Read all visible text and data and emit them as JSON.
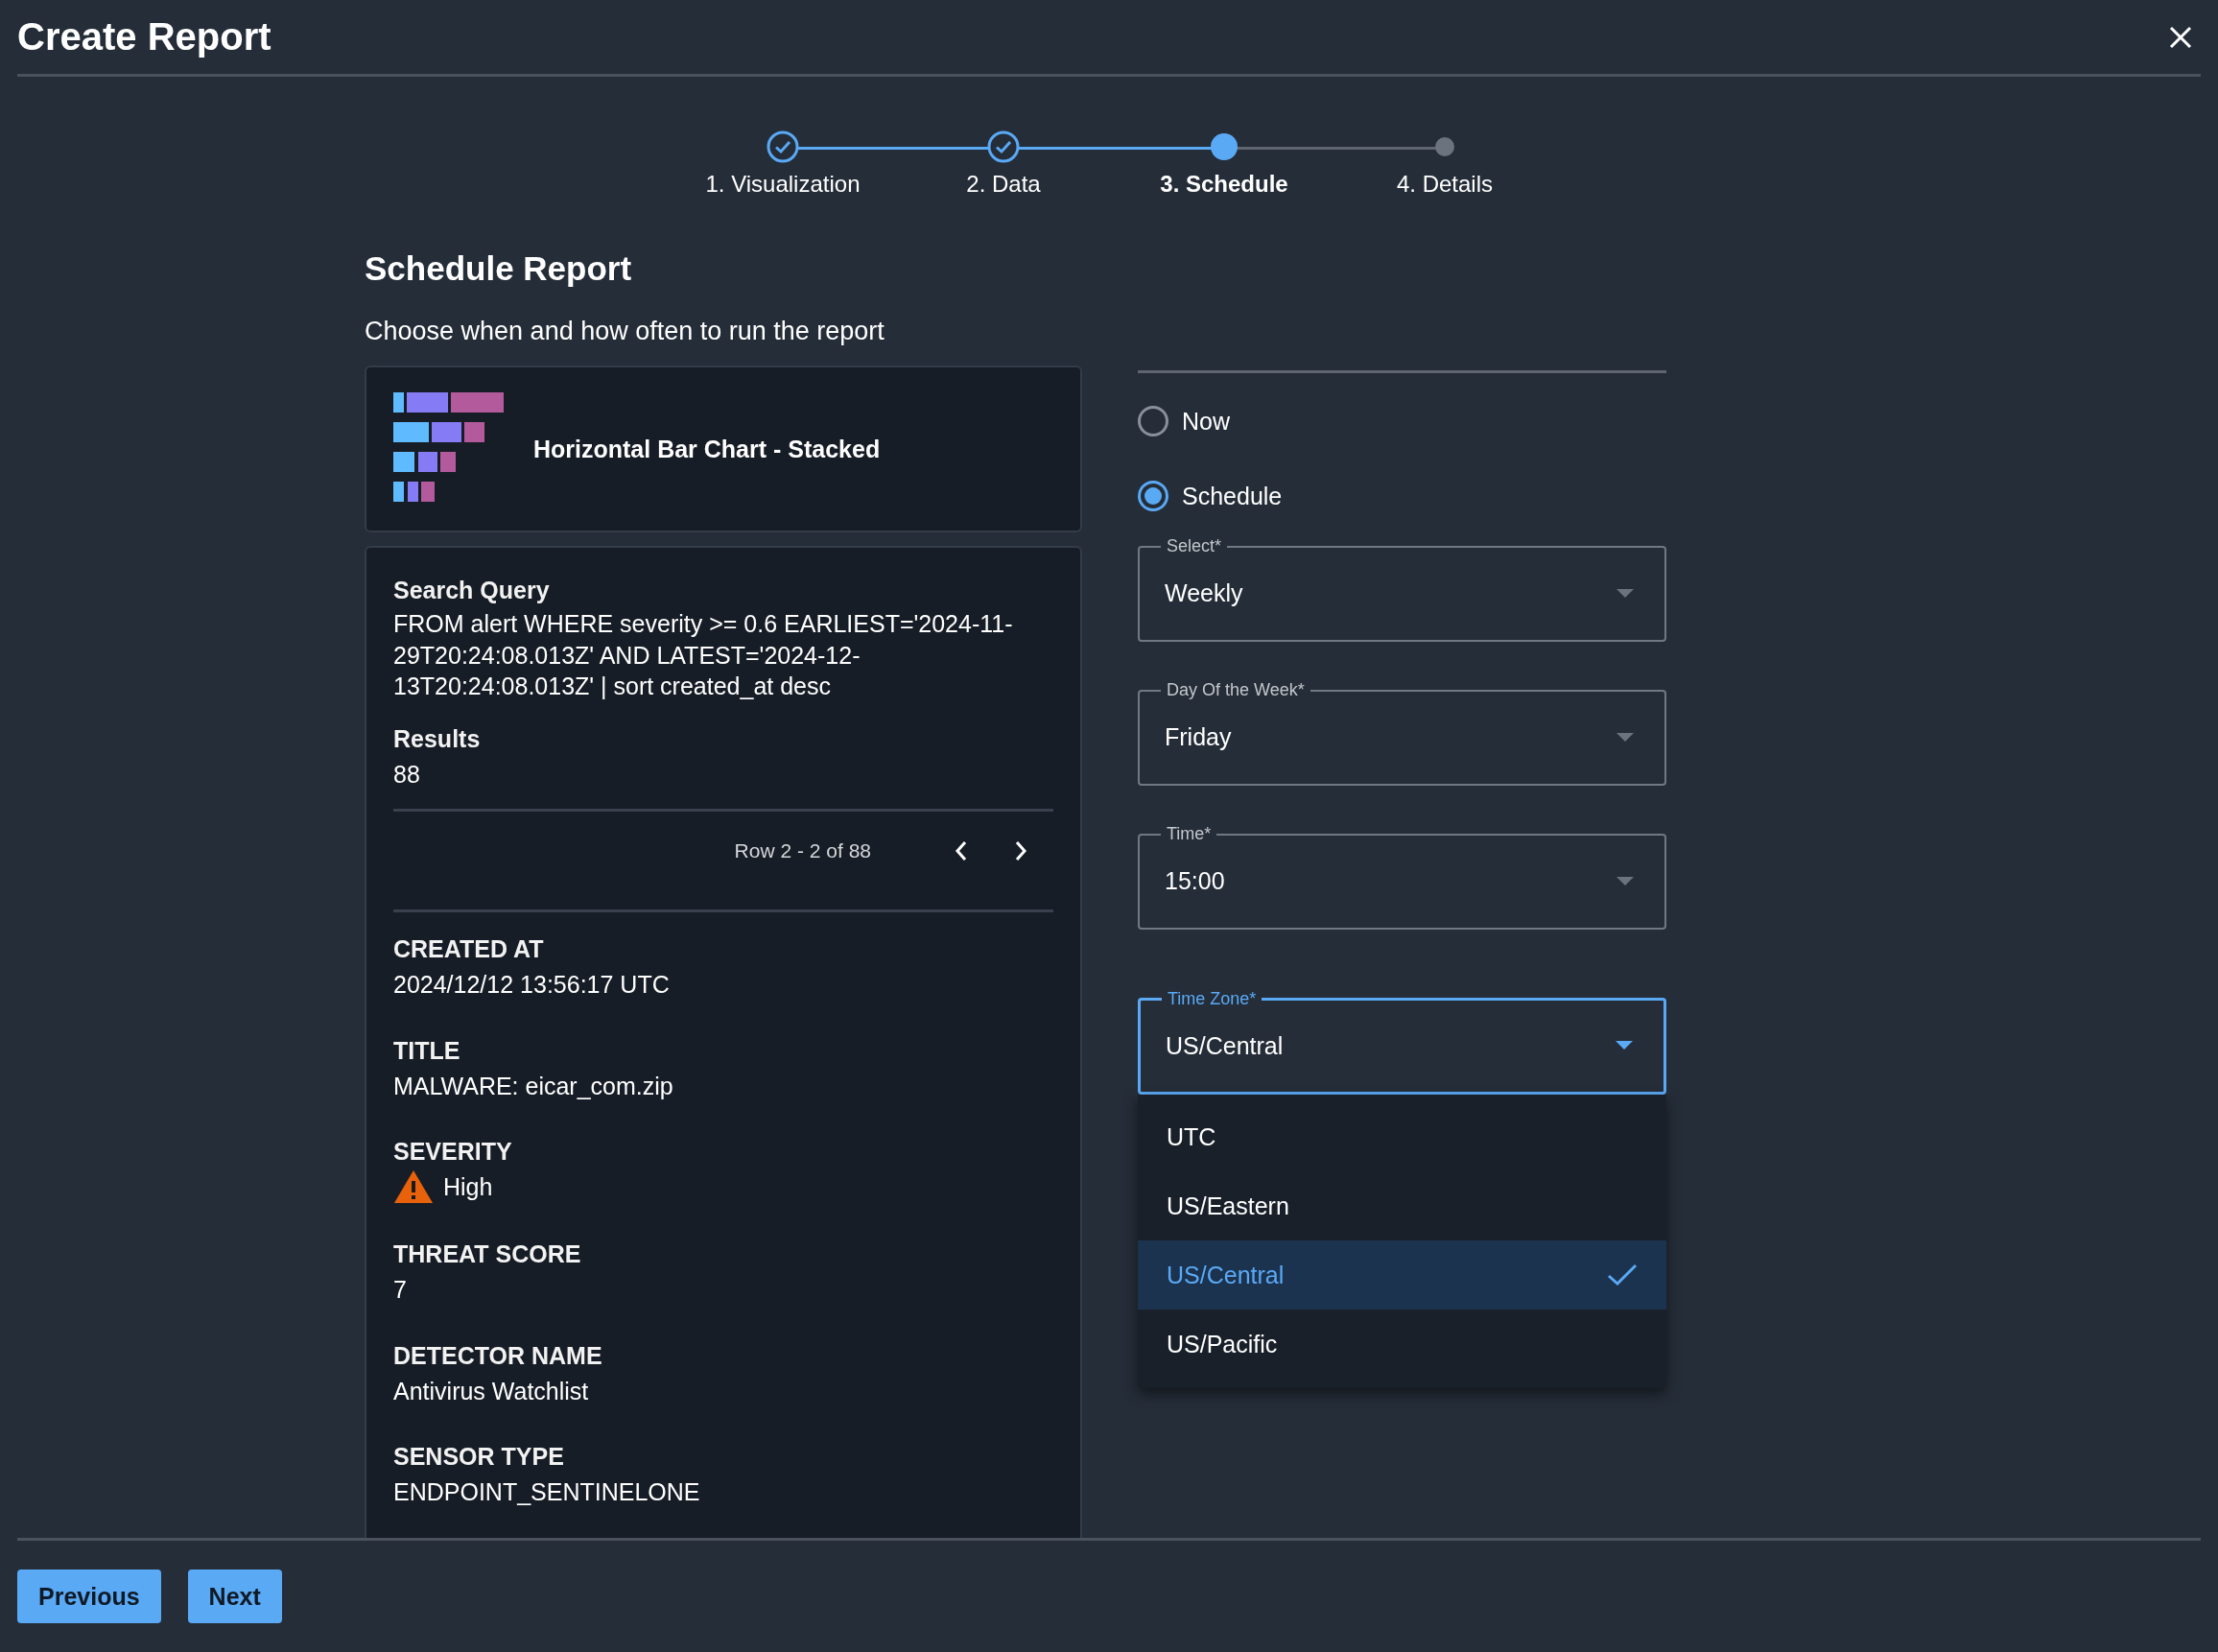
{
  "window": {
    "title": "Create Report"
  },
  "steps": [
    {
      "label": "1. Visualization",
      "kind": "done"
    },
    {
      "label": "2. Data",
      "kind": "done"
    },
    {
      "label": "3. Schedule",
      "kind": "current"
    },
    {
      "label": "4. Details",
      "kind": "pending"
    }
  ],
  "heading": "Schedule Report",
  "subheading": "Choose when and how often to run the report",
  "visualization": {
    "name": "Horizontal Bar Chart - Stacked"
  },
  "query": {
    "label": "Search Query",
    "text": "FROM alert WHERE severity >= 0.6 EARLIEST='2024-11-29T20:24:08.013Z' AND LATEST='2024-12-13T20:24:08.013Z' | sort created_at desc",
    "results_label": "Results",
    "results": "88"
  },
  "pager": {
    "text": "Row 2 - 2 of 88"
  },
  "fields": [
    {
      "kind": "text",
      "label": "CREATED AT",
      "value": "2024/12/12 13:56:17 UTC"
    },
    {
      "kind": "text",
      "label": "TITLE",
      "value": "MALWARE: eicar_com.zip"
    },
    {
      "kind": "severity",
      "label": "SEVERITY",
      "value": "High"
    },
    {
      "kind": "text",
      "label": "THREAT SCORE",
      "value": "7"
    },
    {
      "kind": "text",
      "label": "DETECTOR NAME",
      "value": "Antivirus Watchlist"
    },
    {
      "kind": "text",
      "label": "SENSOR TYPE",
      "value": "ENDPOINT_SENTINELONE"
    }
  ],
  "run_options": [
    {
      "label": "Now",
      "selected": false
    },
    {
      "label": "Schedule",
      "selected": true
    }
  ],
  "selects": [
    {
      "label": "Select*",
      "value": "Weekly",
      "focused": false
    },
    {
      "label": "Day Of the Week*",
      "value": "Friday",
      "focused": false
    },
    {
      "label": "Time*",
      "value": "15:00",
      "focused": false
    },
    {
      "label": "Time Zone*",
      "value": "US/Central",
      "focused": true
    }
  ],
  "timezone_menu": [
    {
      "label": "UTC",
      "selected": false
    },
    {
      "label": "US/Eastern",
      "selected": false
    },
    {
      "label": "US/Central",
      "selected": true
    },
    {
      "label": "US/Pacific",
      "selected": false
    }
  ],
  "buttons": [
    "Previous",
    "Next"
  ]
}
